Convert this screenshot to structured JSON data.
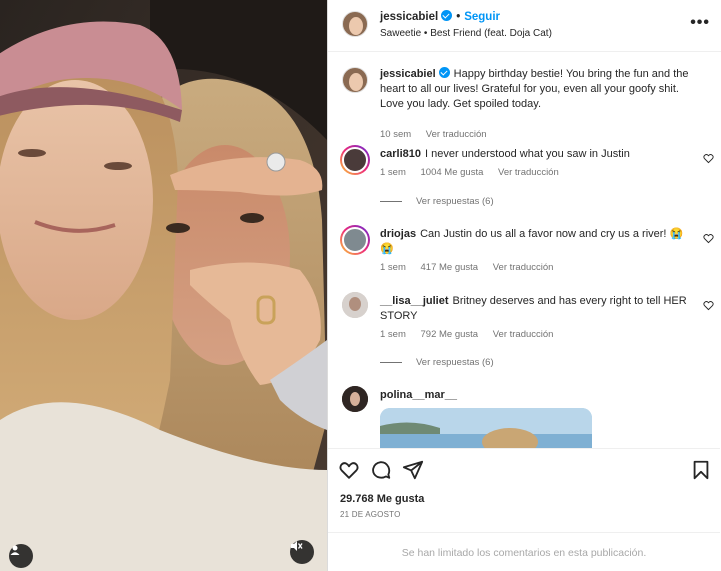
{
  "header": {
    "username": "jessicabiel",
    "verified": true,
    "follow_label": "Seguir",
    "separator": "•",
    "song": "Saweetie • Best Friend (feat. Doja Cat)",
    "more_icon": "more-horizontal-icon"
  },
  "caption": {
    "username": "jessicabiel",
    "text": "Happy birthday bestie! You bring the fun and the heart to all our lives! Grateful for you, even all your goofy shit. Love you lady. Get spoiled today.",
    "time": "10 sem",
    "translate": "Ver traducción"
  },
  "comments": [
    {
      "username": "carli810",
      "text": "I never understood what you saw in Justin",
      "time": "1 sem",
      "likes": "1004 Me gusta",
      "translate": "Ver traducción",
      "replies": "Ver respuestas (6)"
    },
    {
      "username": "driojas",
      "text": "Can Justin do us all a favor now and cry us a river! 😭 😭",
      "time": "1 sem",
      "likes": "417 Me gusta",
      "translate": "Ver traducción",
      "replies": ""
    },
    {
      "username": "__lisa__juliet",
      "text": "Britney deserves and has every right to tell HER STORY",
      "time": "1 sem",
      "likes": "792 Me gusta",
      "translate": "Ver traducción",
      "replies": "Ver respuestas (6)"
    },
    {
      "username": "polina__mar__",
      "text": "",
      "time": "",
      "likes": "",
      "translate": "",
      "replies": ""
    }
  ],
  "actions": {
    "like_icon": "heart-icon",
    "comment_icon": "comment-icon",
    "share_icon": "share-icon",
    "save_icon": "bookmark-icon"
  },
  "stats": {
    "likes": "29.768 Me gusta",
    "date": "21 DE AGOSTO"
  },
  "footer": {
    "limited_comments": "Se han limitado los comentarios en esta publicación."
  },
  "photo": {
    "tag_icon": "user-tag-icon",
    "mute_icon": "speaker-muted-icon"
  },
  "colors": {
    "accent": "#0095f6",
    "muted_text": "#737373",
    "border": "#dbdbdb"
  }
}
